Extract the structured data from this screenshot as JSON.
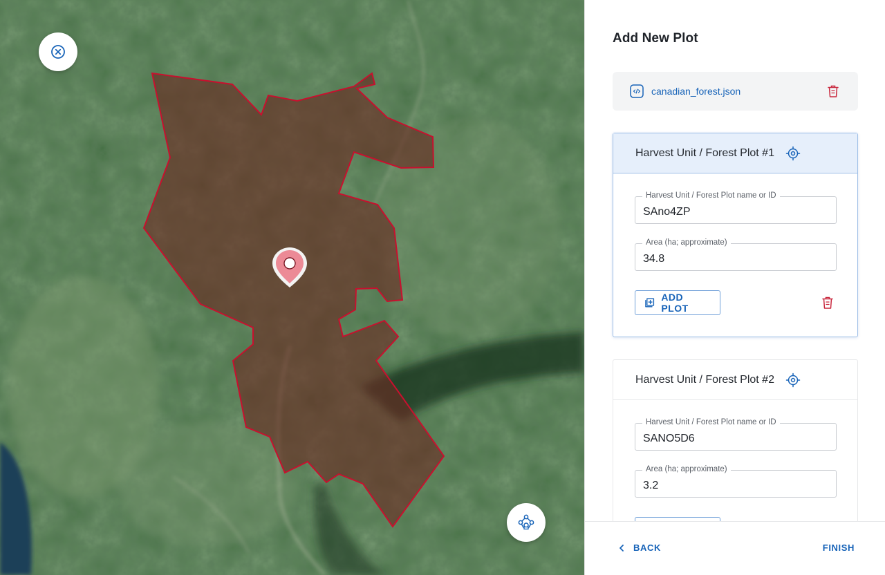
{
  "panel": {
    "title": "Add New Plot",
    "file": {
      "name": "canadian_forest.json"
    }
  },
  "plots": [
    {
      "title": "Harvest Unit / Forest Plot #1",
      "name_label": "Harvest Unit / Forest Plot name or ID",
      "name_value": "SAno4ZP",
      "area_label": "Area (ha; approximate)",
      "area_value": "34.8",
      "add_label": "ADD PLOT"
    },
    {
      "title": "Harvest Unit / Forest Plot #2",
      "name_label": "Harvest Unit / Forest Plot name or ID",
      "name_value": "SANO5D6",
      "area_label": "Area (ha; approximate)",
      "area_value": "3.2"
    }
  ],
  "footer": {
    "back_label": "BACK",
    "finish_label": "FINISH"
  },
  "colors": {
    "accent": "#1763b8",
    "danger": "#c9283e",
    "polygon_stroke": "#c8102e",
    "active_header": "#e6effb"
  },
  "icons": {
    "close": "close-circle-icon",
    "nodes": "polygon-nodes-icon",
    "pin": "map-pin-icon",
    "file": "json-file-icon",
    "delete": "trash-icon",
    "locate": "crosshair-target-icon",
    "add": "add-plot-icon",
    "back": "chevron-left-icon"
  }
}
